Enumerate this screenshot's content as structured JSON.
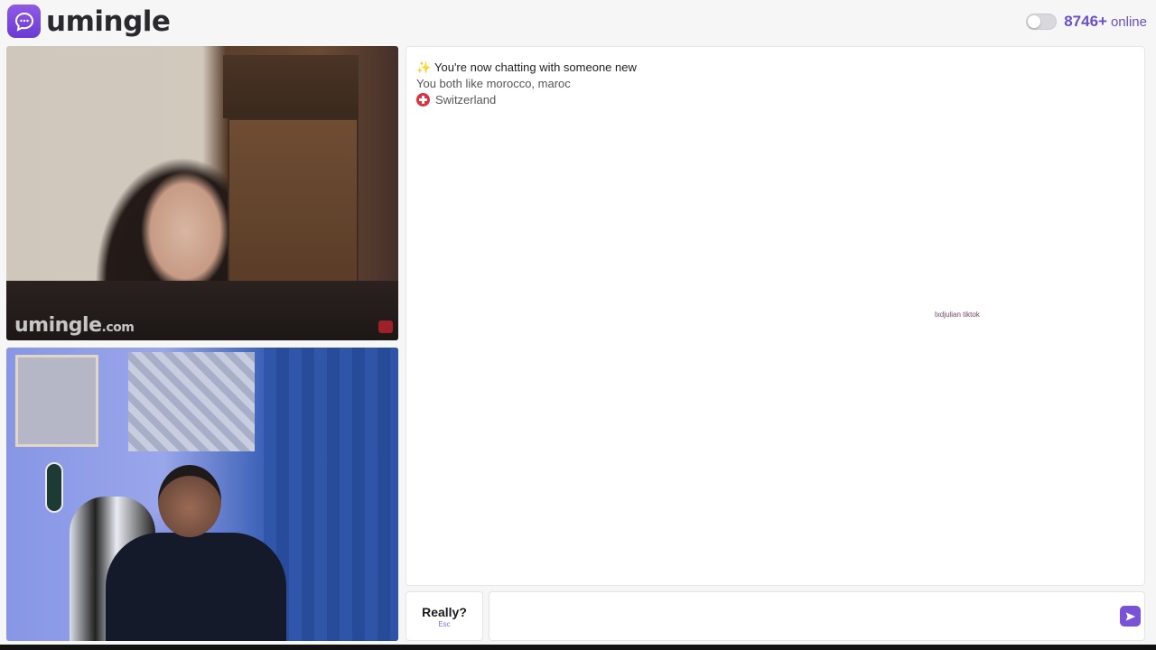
{
  "header": {
    "brand": "umingle",
    "online_count": "8746+",
    "online_label": "online"
  },
  "stranger_video": {
    "watermark_main": "umingle",
    "watermark_suffix": ".com"
  },
  "chat": {
    "system_messages": [
      "You're now chatting with someone new",
      "You both like morocco, maroc",
      "Switzerland"
    ],
    "overlay_text": "lxdjulian tiktok"
  },
  "controls": {
    "skip_label": "Really?",
    "skip_key": "Esc",
    "message_placeholder": ""
  },
  "colors": {
    "accent": "#6b4fc9",
    "brand_icon": "#7a52d6"
  }
}
